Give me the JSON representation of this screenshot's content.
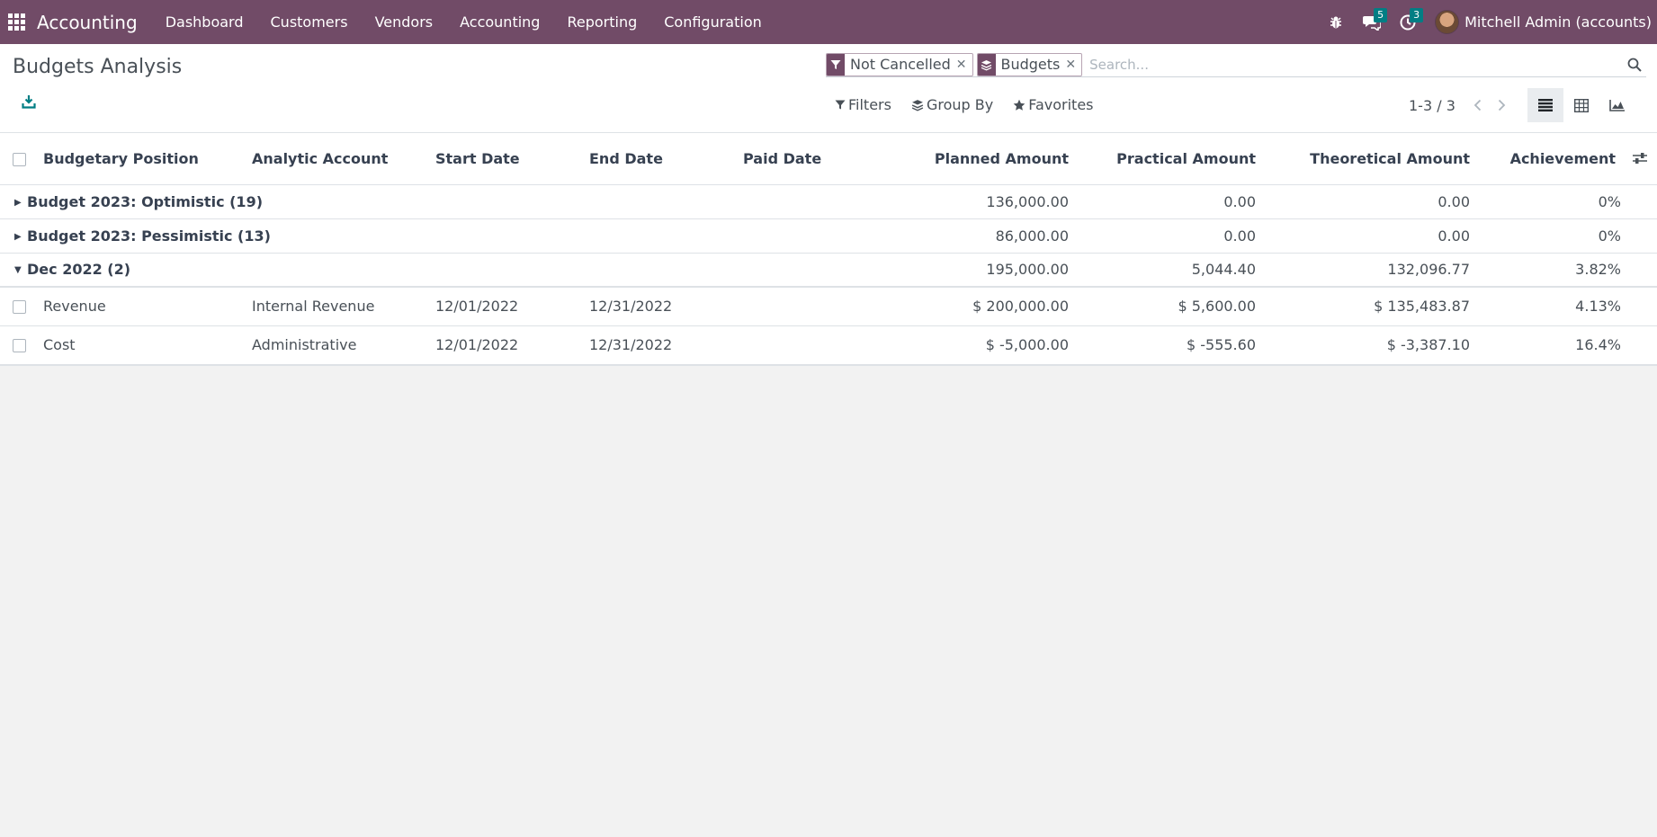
{
  "navbar": {
    "brand": "Accounting",
    "menu": [
      "Dashboard",
      "Customers",
      "Vendors",
      "Accounting",
      "Reporting",
      "Configuration"
    ],
    "messages_count": "5",
    "activities_count": "3",
    "user_name": "Mitchell Admin (accounts)"
  },
  "page": {
    "title": "Budgets Analysis"
  },
  "search": {
    "facets": [
      {
        "icon": "filter-icon",
        "label": "Not Cancelled"
      },
      {
        "icon": "layers-icon",
        "label": "Budgets"
      }
    ],
    "placeholder": "Search..."
  },
  "toolbar": {
    "filters": "Filters",
    "group_by": "Group By",
    "favorites": "Favorites",
    "pager": "1-3 / 3"
  },
  "table": {
    "columns": [
      "Budgetary Position",
      "Analytic Account",
      "Start Date",
      "End Date",
      "Paid Date",
      "Planned Amount",
      "Practical Amount",
      "Theoretical Amount",
      "Achievement"
    ],
    "groups": [
      {
        "label": "Budget 2023: Optimistic (19)",
        "expanded": false,
        "planned": "136,000.00",
        "practical": "0.00",
        "theoretical": "0.00",
        "achievement": "0%"
      },
      {
        "label": "Budget 2023: Pessimistic (13)",
        "expanded": false,
        "planned": "86,000.00",
        "practical": "0.00",
        "theoretical": "0.00",
        "achievement": "0%"
      },
      {
        "label": "Dec 2022 (2)",
        "expanded": true,
        "planned": "195,000.00",
        "practical": "5,044.40",
        "theoretical": "132,096.77",
        "achievement": "3.82%"
      }
    ],
    "records": [
      {
        "position": "Revenue",
        "analytic": "Internal Revenue",
        "start": "12/01/2022",
        "end": "12/31/2022",
        "paid": "",
        "planned": "$ 200,000.00",
        "practical": "$ 5,600.00",
        "theoretical": "$ 135,483.87",
        "achievement": "4.13%"
      },
      {
        "position": "Cost",
        "analytic": "Administrative",
        "start": "12/01/2022",
        "end": "12/31/2022",
        "paid": "",
        "planned": "$ -5,000.00",
        "practical": "$ -555.60",
        "theoretical": "$ -3,387.10",
        "achievement": "16.4%"
      }
    ]
  },
  "colors": {
    "brand": "#714B67",
    "badge": "#017e84"
  }
}
